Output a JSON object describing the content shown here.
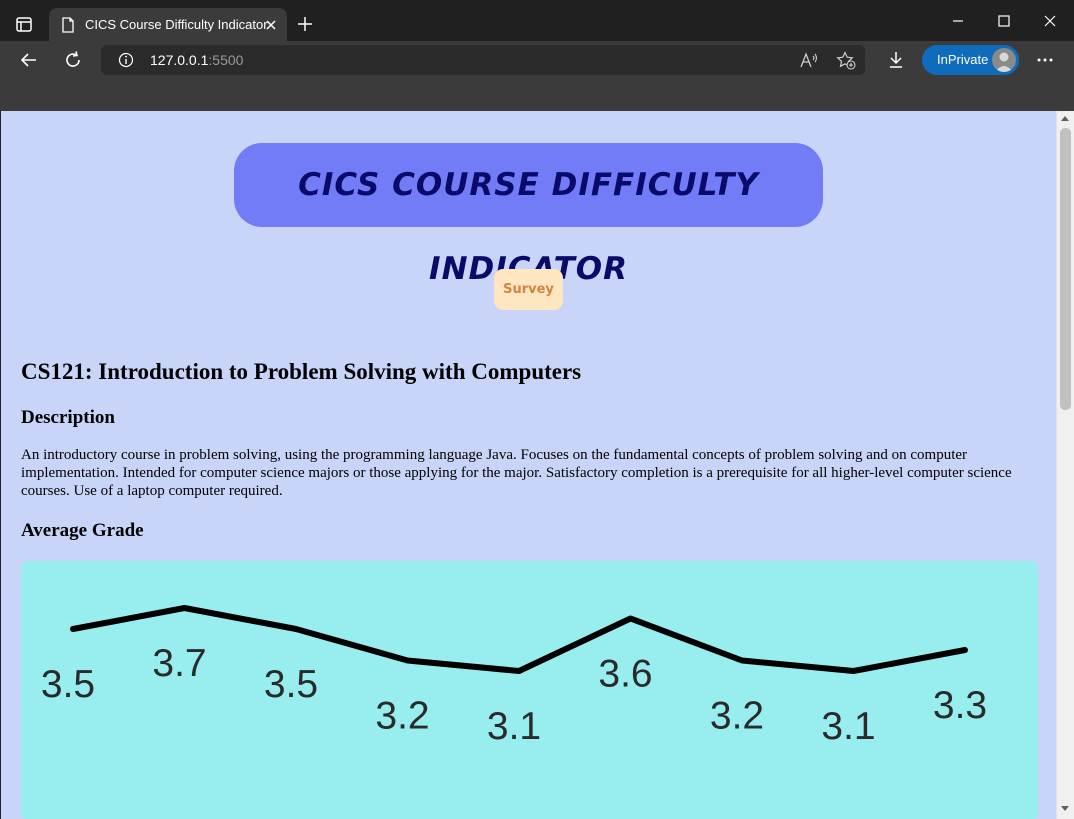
{
  "browser": {
    "tab_title": "CICS Course Difficulty Indicator",
    "url_host": "127.0.0.1",
    "url_port": ":5500",
    "inprivate_label": "InPrivate"
  },
  "page": {
    "banner_title": "CICS COURSE DIFFICULTY INDICATOR",
    "survey_label": "Survey",
    "course_title": "CS121: Introduction to Problem Solving with Computers",
    "description_heading": "Description",
    "description_text": "An introductory course in problem solving, using the programming language Java. Focuses on the fundamental concepts of problem solving and on computer implementation. Intended for computer science majors or those applying for the major. Satisfactory completion is a prerequisite for all higher-level computer science courses. Use of a laptop computer required.",
    "average_grade_heading": "Average Grade"
  },
  "colors": {
    "banner_bg": "#717cf6",
    "banner_text": "#0a0a6b",
    "page_bg": "#c8d5f8",
    "survey_bg": "#fde6c0",
    "survey_text": "#d2853e",
    "chart_bg": "#98eeee"
  },
  "chart_data": {
    "type": "line",
    "values": [
      3.5,
      3.7,
      3.5,
      3.2,
      3.1,
      3.6,
      3.2,
      3.1,
      3.3
    ],
    "data_labels": [
      "3.5",
      "3.7",
      "3.5",
      "3.2",
      "3.1",
      "3.6",
      "3.2",
      "3.1",
      "3.3"
    ],
    "line_color": "#000000"
  }
}
